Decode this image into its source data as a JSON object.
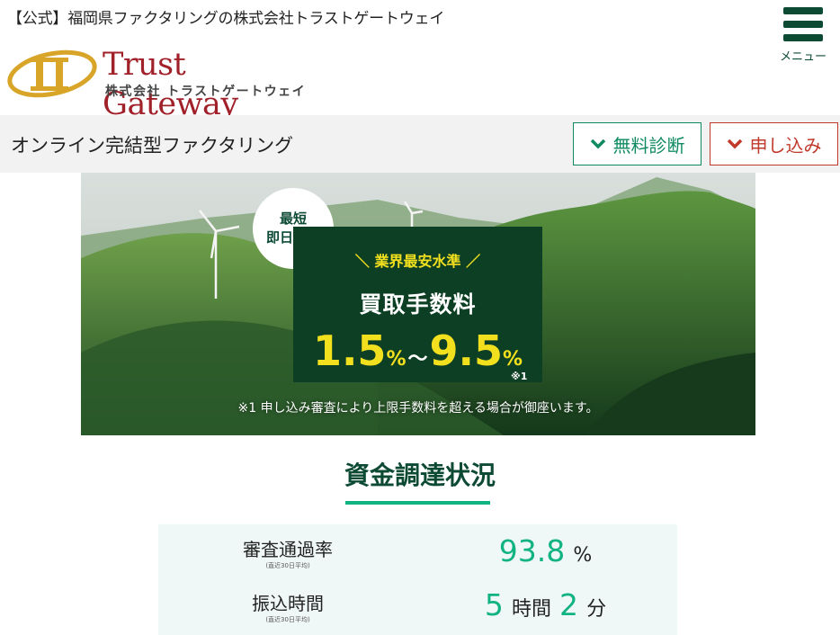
{
  "header": {
    "tagline": "【公式】福岡県ファクタリングの株式会社トラストゲートウェイ",
    "logo_title": "Trust Gateway",
    "logo_sub": "株式会社 トラストゲートウェイ",
    "menu_label": "メニュー"
  },
  "subbar": {
    "title": "オンライン完結型ファクタリング",
    "free_button": "無料診断",
    "apply_button": "申し込み"
  },
  "hero": {
    "badge_line1": "最短",
    "badge_line2": "即日振込",
    "promo_line1": "＼ 業界最安水準 ／",
    "promo_line2": "買取手数料",
    "rate_low": "1.5",
    "rate_high": "9.5",
    "percent": "%",
    "tilde": "～",
    "note_mark": "※1",
    "footnote": "※1 申し込み審査により上限手数料を超える場合が御座います。"
  },
  "funding": {
    "title": "資金調達状況",
    "rows": [
      {
        "label": "審査通過率",
        "sub": "(直近30日平均)",
        "value": "93.8",
        "unit": "%"
      },
      {
        "label": "振込時間",
        "sub": "(直近30日平均)",
        "hours": "5",
        "hours_unit": "時間",
        "minutes": "2",
        "minutes_unit": "分"
      }
    ]
  },
  "colors": {
    "brand_green": "#0d4a34",
    "accent_green": "#12b383",
    "apply_red": "#c0392b",
    "promo_yellow": "#f2e01f"
  }
}
